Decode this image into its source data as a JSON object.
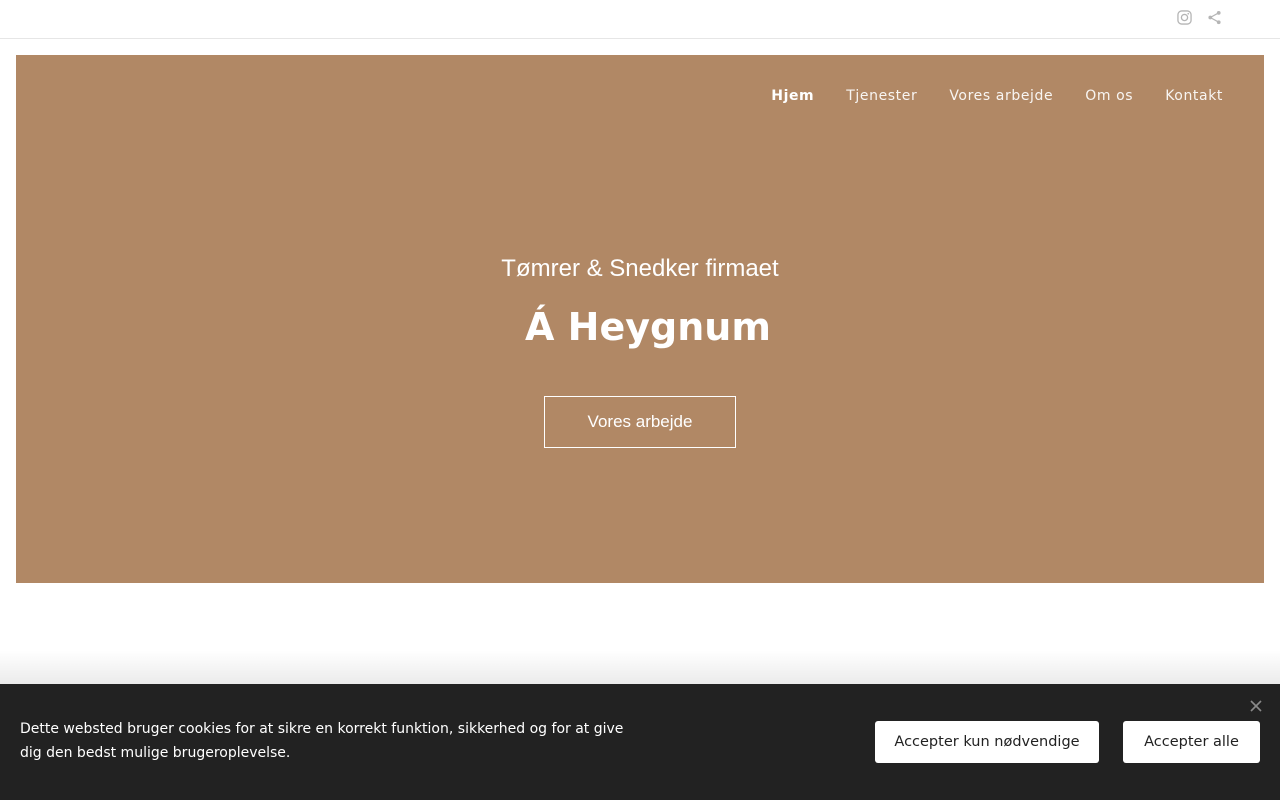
{
  "topbar": {
    "icons": [
      "instagram-icon",
      "share-icon"
    ],
    "icon_color": "#b5b5b5"
  },
  "nav": {
    "items": [
      {
        "label": "Hjem",
        "active": true
      },
      {
        "label": "Tjenester",
        "active": false
      },
      {
        "label": "Vores arbejde",
        "active": false
      },
      {
        "label": "Om os",
        "active": false
      },
      {
        "label": "Kontakt",
        "active": false
      }
    ]
  },
  "hero": {
    "subtitle": "Tømrer & Snedker firmaet",
    "title": "Á Heygnum",
    "button_label": "Vores arbejde",
    "background_color": "#b18865"
  },
  "cookie": {
    "text": "Dette websted bruger cookies for at sikre en korrekt funktion, sikkerhed og for at give dig den bedst mulige brugeroplevelse.",
    "accept_necessary_label": "Accepter kun nødvendige",
    "accept_all_label": "Accepter alle",
    "close_icon": "close-icon",
    "background_color": "#222222"
  }
}
